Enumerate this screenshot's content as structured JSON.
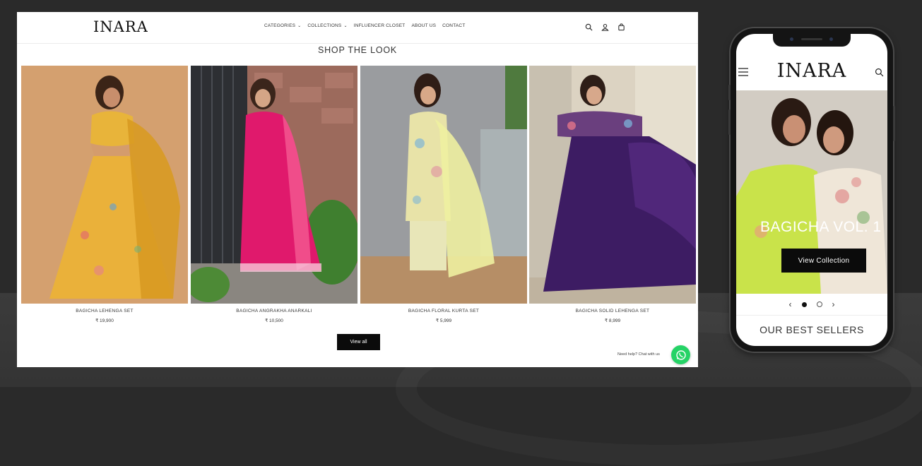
{
  "desktop": {
    "logo": "INARA",
    "nav": [
      {
        "label": "CATEGORIES",
        "has_dropdown": true
      },
      {
        "label": "COLLECTIONS",
        "has_dropdown": true
      },
      {
        "label": "INFLUENCER CLOSET",
        "has_dropdown": false
      },
      {
        "label": "ABOUT US",
        "has_dropdown": false
      },
      {
        "label": "CONTACT",
        "has_dropdown": false
      }
    ],
    "header_icons": [
      "search-icon",
      "account-icon",
      "cart-icon"
    ],
    "section_title": "SHOP THE LOOK",
    "products": [
      {
        "name": "BAGICHA LEHENGA SET",
        "price": "₹ 19,900"
      },
      {
        "name": "BAGICHA ANGRAKHA ANARKALI",
        "price": "₹ 10,500"
      },
      {
        "name": "BAGICHA FLORAL KURTA SET",
        "price": "₹ 5,999"
      },
      {
        "name": "BAGICHA SOLID LEHENGA SET",
        "price": "₹ 8,999"
      }
    ],
    "view_all_label": "View all",
    "help_text": "Need help? Chat with us"
  },
  "mobile": {
    "logo": "INARA",
    "hero_title": "BAGICHA VOL. 1",
    "hero_button": "View Collection",
    "slides": {
      "current": 1,
      "total": 2
    },
    "section_title": "OUR BEST SELLERS"
  },
  "colors": {
    "background": "#2a2a2a",
    "button": "#0b0b0b",
    "whatsapp": "#25d366"
  }
}
